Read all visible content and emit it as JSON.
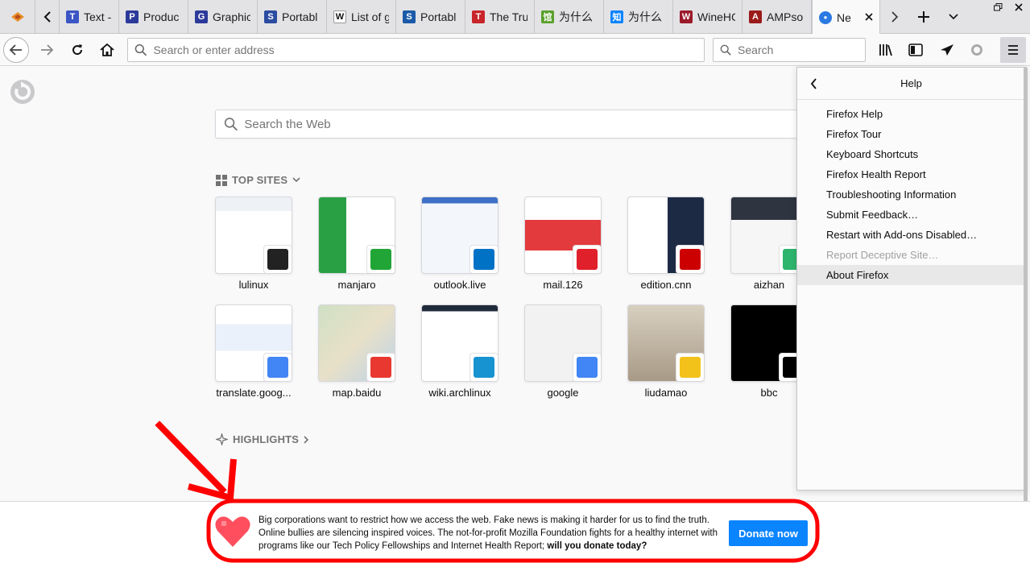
{
  "tabs": [
    {
      "label": "Text - F",
      "color": "#3b55c4",
      "glyph": "T"
    },
    {
      "label": "Produc",
      "color": "#2b3a9a",
      "glyph": "P"
    },
    {
      "label": "Graphic",
      "color": "#2b3a9a",
      "glyph": "G"
    },
    {
      "label": "Portabl",
      "color": "#2b4ca0",
      "glyph": "S"
    },
    {
      "label": "List of g",
      "color": "#ffffff",
      "glyph": "W"
    },
    {
      "label": "Portabl",
      "color": "#1a5aa8",
      "glyph": "S"
    },
    {
      "label": "The Tru",
      "color": "#c8242a",
      "glyph": "T"
    },
    {
      "label": "为什么",
      "color": "#5aa02c",
      "glyph": "馆"
    },
    {
      "label": "为什么",
      "color": "#0a84ff",
      "glyph": "知"
    },
    {
      "label": "WineHC",
      "color": "#9b1a2a",
      "glyph": "W"
    },
    {
      "label": "AMPso",
      "color": "#9b1a1a",
      "glyph": "A"
    },
    {
      "label": "Ne",
      "color": "#2a7ae2",
      "glyph": "●"
    }
  ],
  "navbar": {
    "url_placeholder": "Search or enter address",
    "search_placeholder": "Search"
  },
  "newtab": {
    "search_placeholder": "Search the Web",
    "top_sites_heading": "TOP SITES",
    "highlights_heading": "HIGHLIGHTS",
    "sites": [
      {
        "label": "lulinux",
        "icon": "penguin-icon",
        "badge_color": "#222222"
      },
      {
        "label": "manjaro",
        "icon": "bar-icon",
        "badge_color": "#21a536"
      },
      {
        "label": "outlook.live",
        "icon": "outlook-icon",
        "badge_color": "#0072c6"
      },
      {
        "label": "mail.126",
        "icon": "mail126-icon",
        "badge_color": "#e0202a"
      },
      {
        "label": "edition.cnn",
        "icon": "cnn-icon",
        "badge_color": "#cc0000"
      },
      {
        "label": "aizhan",
        "icon": "aizhan-icon",
        "badge_color": "#2db56e"
      },
      {
        "label": "translate.goog...",
        "icon": "translate-icon",
        "badge_color": "#4285f4"
      },
      {
        "label": "map.baidu",
        "icon": "baidu-map-icon",
        "badge_color": "#e8382f"
      },
      {
        "label": "wiki.archlinux",
        "icon": "arch-icon",
        "badge_color": "#1793d1"
      },
      {
        "label": "google",
        "icon": "google-icon",
        "badge_color": "#4285f4"
      },
      {
        "label": "liudamao",
        "icon": "liudamao-icon",
        "badge_color": "#f2c21b"
      },
      {
        "label": "bbc",
        "icon": "bbc-icon",
        "badge_color": "#000000"
      }
    ]
  },
  "help_panel": {
    "title": "Help",
    "items": [
      {
        "label": "Firefox Help",
        "disabled": false
      },
      {
        "label": "Firefox Tour",
        "disabled": false
      },
      {
        "label": "Keyboard Shortcuts",
        "disabled": false
      },
      {
        "label": "Firefox Health Report",
        "disabled": false
      },
      {
        "label": "Troubleshooting Information",
        "disabled": false
      },
      {
        "label": "Submit Feedback…",
        "disabled": false
      },
      {
        "label": "Restart with Add-ons Disabled…",
        "disabled": false
      },
      {
        "label": "Report Deceptive Site…",
        "disabled": true
      },
      {
        "label": "About Firefox",
        "disabled": false
      }
    ]
  },
  "donate": {
    "text": "Big corporations want to restrict how we access the web. Fake news is making it harder for us to find the truth. Online bullies are silencing inspired voices. The not-for-profit Mozilla Foundation fights for a healthy internet with programs like our Tech Policy Fellowships and Internet Health Report; ",
    "bold_text": "will you donate today?",
    "button_label": "Donate now"
  },
  "colors": {
    "accent": "#0a84ff",
    "annotation": "#ff0000"
  }
}
